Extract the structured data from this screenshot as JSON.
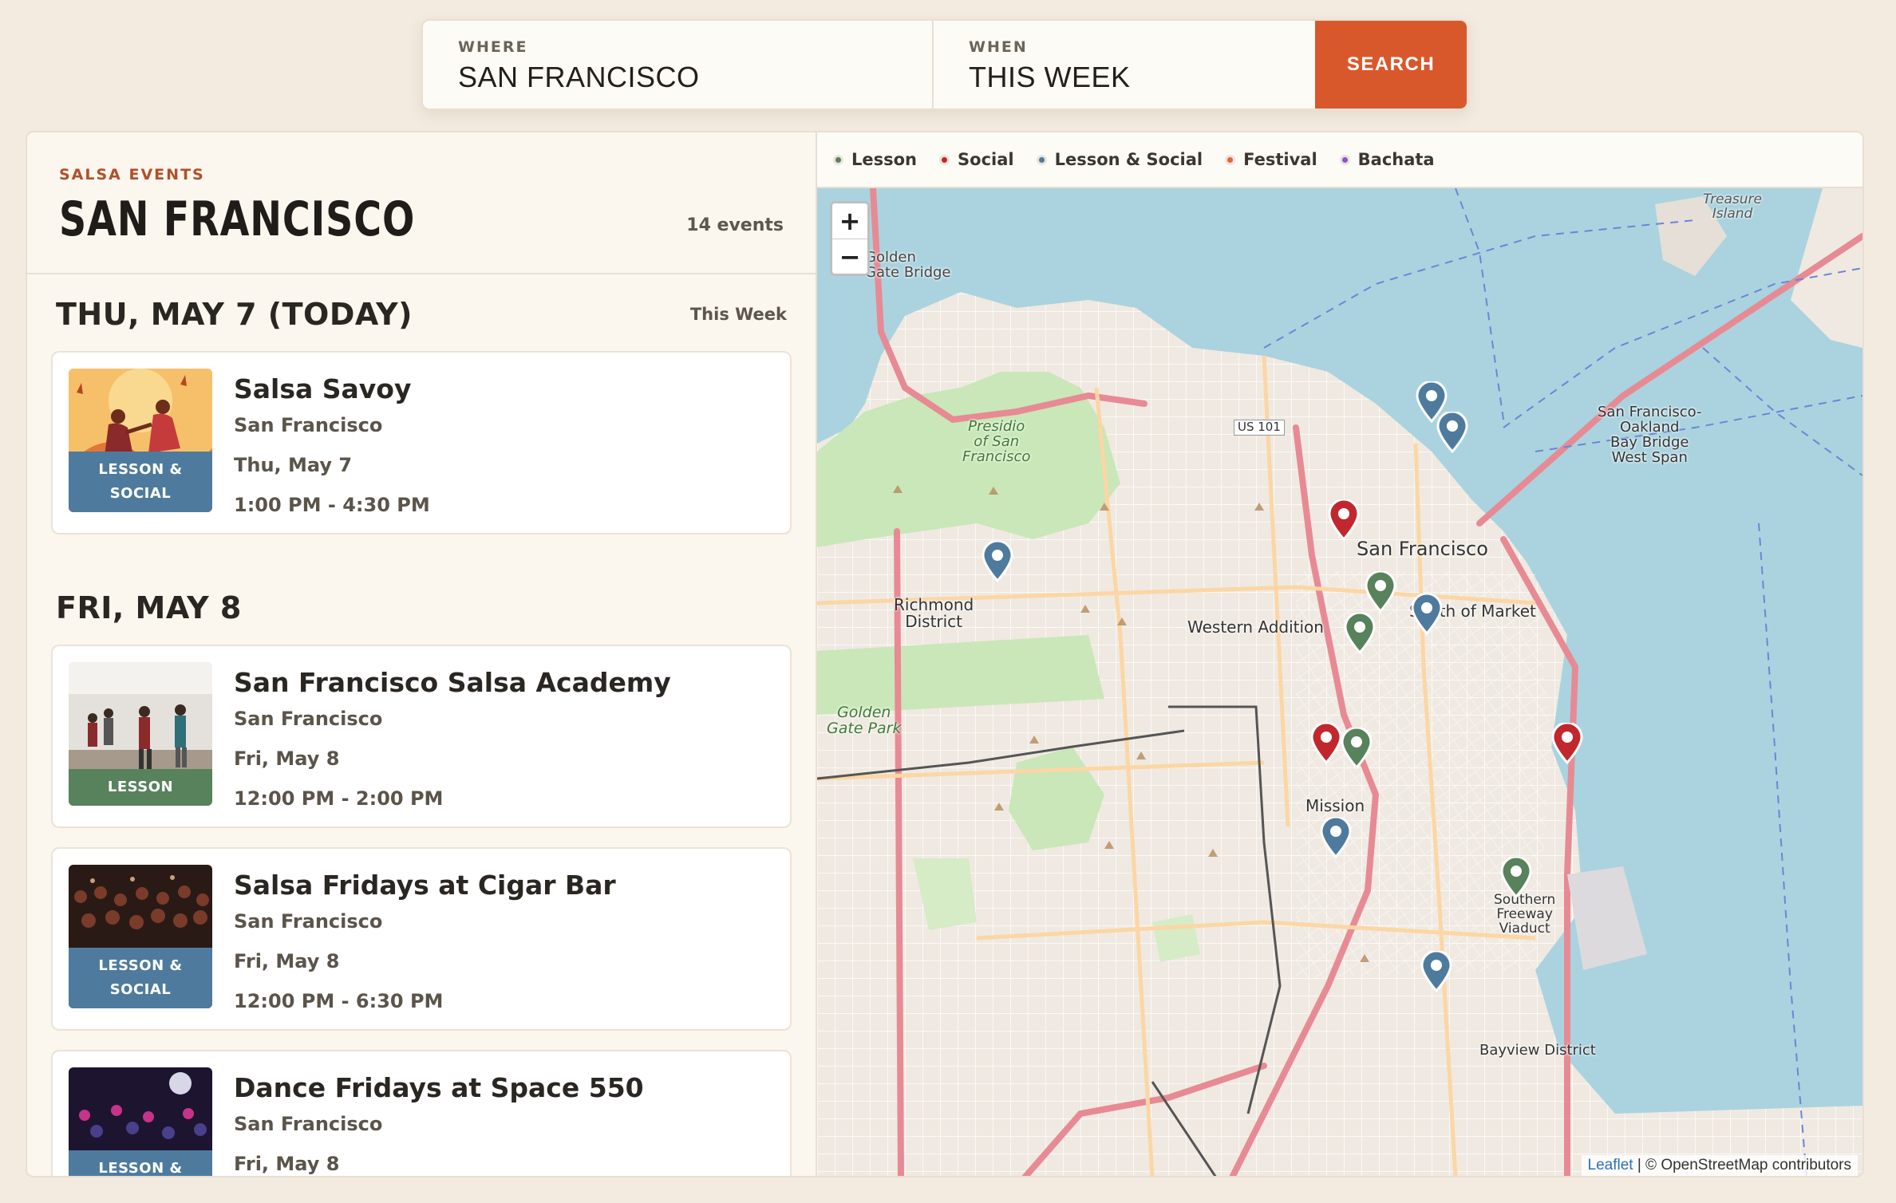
{
  "search": {
    "where_label": "WHERE",
    "where_value": "SAN FRANCISCO",
    "when_label": "WHEN",
    "when_value": "THIS WEEK",
    "button": "SEARCH"
  },
  "panel": {
    "eyebrow": "SALSA EVENTS",
    "city": "SAN FRANCISCO",
    "count": "14 events"
  },
  "days": [
    {
      "date": "THU, MAY 7 (TODAY)",
      "tag": "This Week",
      "events": [
        {
          "name": "Salsa Savoy",
          "location": "San Francisco",
          "date": "Thu, May 7",
          "time": "1:00 PM - 4:30 PM",
          "badge": "LESSON & SOCIAL",
          "badge_color": "#4e7b9d"
        }
      ]
    },
    {
      "date": "FRI, MAY 8",
      "tag": "",
      "events": [
        {
          "name": "San Francisco Salsa Academy",
          "location": "San Francisco",
          "date": "Fri, May 8",
          "time": "12:00 PM - 2:00 PM",
          "badge": "LESSON",
          "badge_color": "#57825b"
        },
        {
          "name": "Salsa Fridays at Cigar Bar",
          "location": "San Francisco",
          "date": "Fri, May 8",
          "time": "12:00 PM - 6:30 PM",
          "badge": "LESSON & SOCIAL",
          "badge_color": "#4e7b9d"
        },
        {
          "name": "Dance Fridays at Space 550",
          "location": "San Francisco",
          "date": "Fri, May 8",
          "time": "",
          "badge": "LESSON & SOCIAL",
          "badge_color": "#4e7b9d"
        }
      ]
    }
  ],
  "legend": [
    {
      "label": "Lesson",
      "color": "#57825b"
    },
    {
      "label": "Social",
      "color": "#c1272d"
    },
    {
      "label": "Lesson & Social",
      "color": "#4e7b9d"
    },
    {
      "label": "Festival",
      "color": "#e8643a"
    },
    {
      "label": "Bachata",
      "color": "#8a55c9"
    }
  ],
  "map": {
    "zoom_in": "+",
    "zoom_out": "−",
    "attribution_leaflet": "Leaflet",
    "attribution_rest": "| © OpenStreetMap contributors",
    "labels": {
      "golden_gate": "Golden\nGate Bridge",
      "treasure_island": "Treasure\nIsland",
      "presidio": "Presidio\nof San\nFrancisco",
      "sf": "San Francisco",
      "richmond": "Richmond\nDistrict",
      "western_addition": "Western Addition",
      "mission": "Mission",
      "bay_bridge": "San Francisco-\nOakland\nBay Bridge\nWest Span",
      "bayview": "Bayview District",
      "gg_park": "Golden\nGate Park",
      "southern_freeway": "Southern\nFreeway\nViaduct",
      "soma": "South of Market",
      "us101": "US 101"
    }
  }
}
